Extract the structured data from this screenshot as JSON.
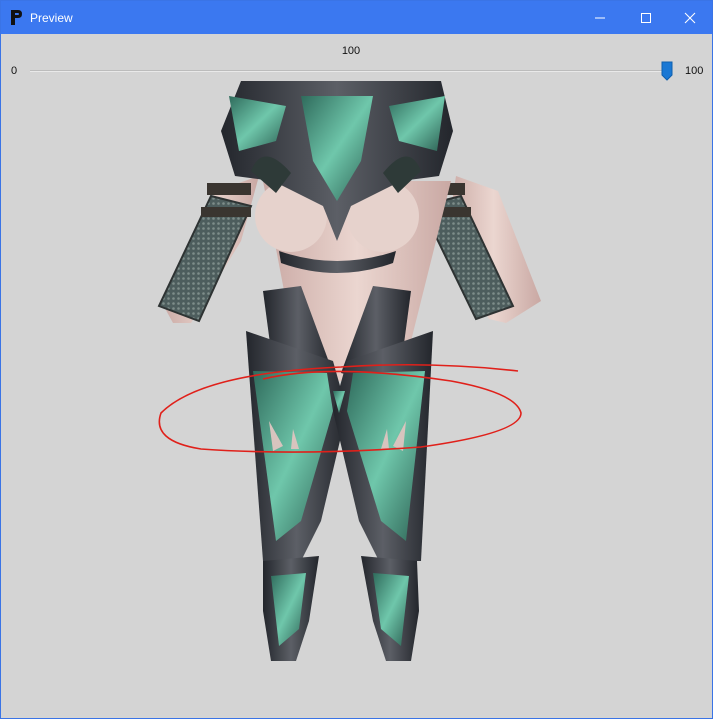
{
  "window": {
    "title": "Preview",
    "app_icon": "app-logo-icon",
    "controls": [
      "minimize-icon",
      "maximize-icon",
      "close-icon"
    ]
  },
  "slider": {
    "value_label": "100",
    "min_label": "0",
    "max_label": "100",
    "value": 100,
    "min": 0,
    "max": 100
  },
  "colors": {
    "titlebar": "#3b78f0",
    "background": "#d4d4d4",
    "thumb": "#1a78d4",
    "annotation": "#e0201a"
  }
}
